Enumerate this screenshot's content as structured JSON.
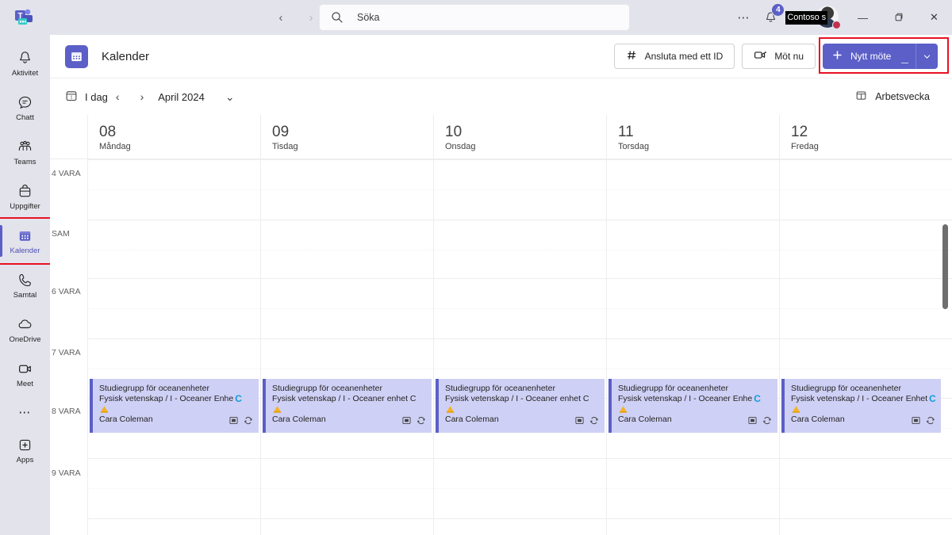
{
  "titlebar": {
    "app_logo": "teams-logo",
    "back_label": "‹",
    "forward_label": "›",
    "search": {
      "placeholder": "Söka",
      "value": ""
    },
    "more_label": "⋯",
    "notification_count": "4",
    "account_tooltip": "Contoso s",
    "minimize_label": "—",
    "maximize_label": "❐",
    "close_label": "✕"
  },
  "sidebar": {
    "items": [
      {
        "label": "Aktivitet",
        "icon": "bell-icon",
        "active": false
      },
      {
        "label": "Chatt",
        "icon": "chat-icon",
        "active": false
      },
      {
        "label": "Teams",
        "icon": "teams-icon",
        "active": false
      },
      {
        "label": "Uppgifter",
        "icon": "tasks-icon",
        "active": false
      },
      {
        "label": "Kalender",
        "icon": "calendar-icon",
        "active": true
      },
      {
        "label": "Samtal",
        "icon": "calls-icon",
        "active": false
      },
      {
        "label": "OneDrive",
        "icon": "cloud-icon",
        "active": false
      },
      {
        "label": "Meet",
        "icon": "video-icon",
        "active": false
      }
    ],
    "more_label": "⋯",
    "apps_label": "Apps"
  },
  "apphead": {
    "title": "Kalender",
    "join_id_label": "Ansluta med ett ID",
    "meet_now_label": "Möt nu",
    "new_meeting_label": "Nytt möte",
    "new_meeting_caret": "⌄"
  },
  "datebar": {
    "today_label": "I dag",
    "prev_label": "‹",
    "next_label": "›",
    "month_label": "April 2024",
    "month_caret": "⌄",
    "view_label": "Arbetsvecka"
  },
  "calendar": {
    "days": [
      {
        "num": "08",
        "name": "Måndag"
      },
      {
        "num": "09",
        "name": "Tisdag"
      },
      {
        "num": "10",
        "name": "Onsdag"
      },
      {
        "num": "11",
        "name": "Torsdag"
      },
      {
        "num": "12",
        "name": "Fredag"
      }
    ],
    "time_labels": [
      "4 VARA",
      "SAM",
      "6 VARA",
      "7 VARA",
      "8 VARA",
      "9 VARA"
    ],
    "events": [
      {
        "title": "Studiegrupp för oceanenheter",
        "subtitle": "Fysisk vetenskap / I - Oceaner Enhe",
        "teams_mark": "C",
        "owner": "Cara Coleman"
      },
      {
        "title": "Studiegrupp för oceanenheter",
        "subtitle": "Fysisk vetenskap / I - Oceaner enhet C",
        "teams_mark": "",
        "owner": "Cara Coleman"
      },
      {
        "title": "Studiegrupp för oceanenheter",
        "subtitle": "Fysisk vetenskap / I - Oceaner enhet C",
        "teams_mark": "",
        "owner": "Cara Coleman"
      },
      {
        "title": "Studiegrupp för oceanenheter",
        "subtitle": "Fysisk vetenskap / I - Oceaner Enhe",
        "teams_mark": "C",
        "owner": "Cara Coleman"
      },
      {
        "title": "Studiegrupp för oceanenheter",
        "subtitle": "Fysisk vetenskap / I - Oceaner Enhet",
        "teams_mark": "C",
        "owner": "Cara Coleman"
      }
    ]
  },
  "colors": {
    "accent": "#5b5fc7",
    "event_bg": "#cfd0f5",
    "rail_bg": "#e3e3ec",
    "highlight": "#e81123",
    "presence": "#c4314b"
  }
}
